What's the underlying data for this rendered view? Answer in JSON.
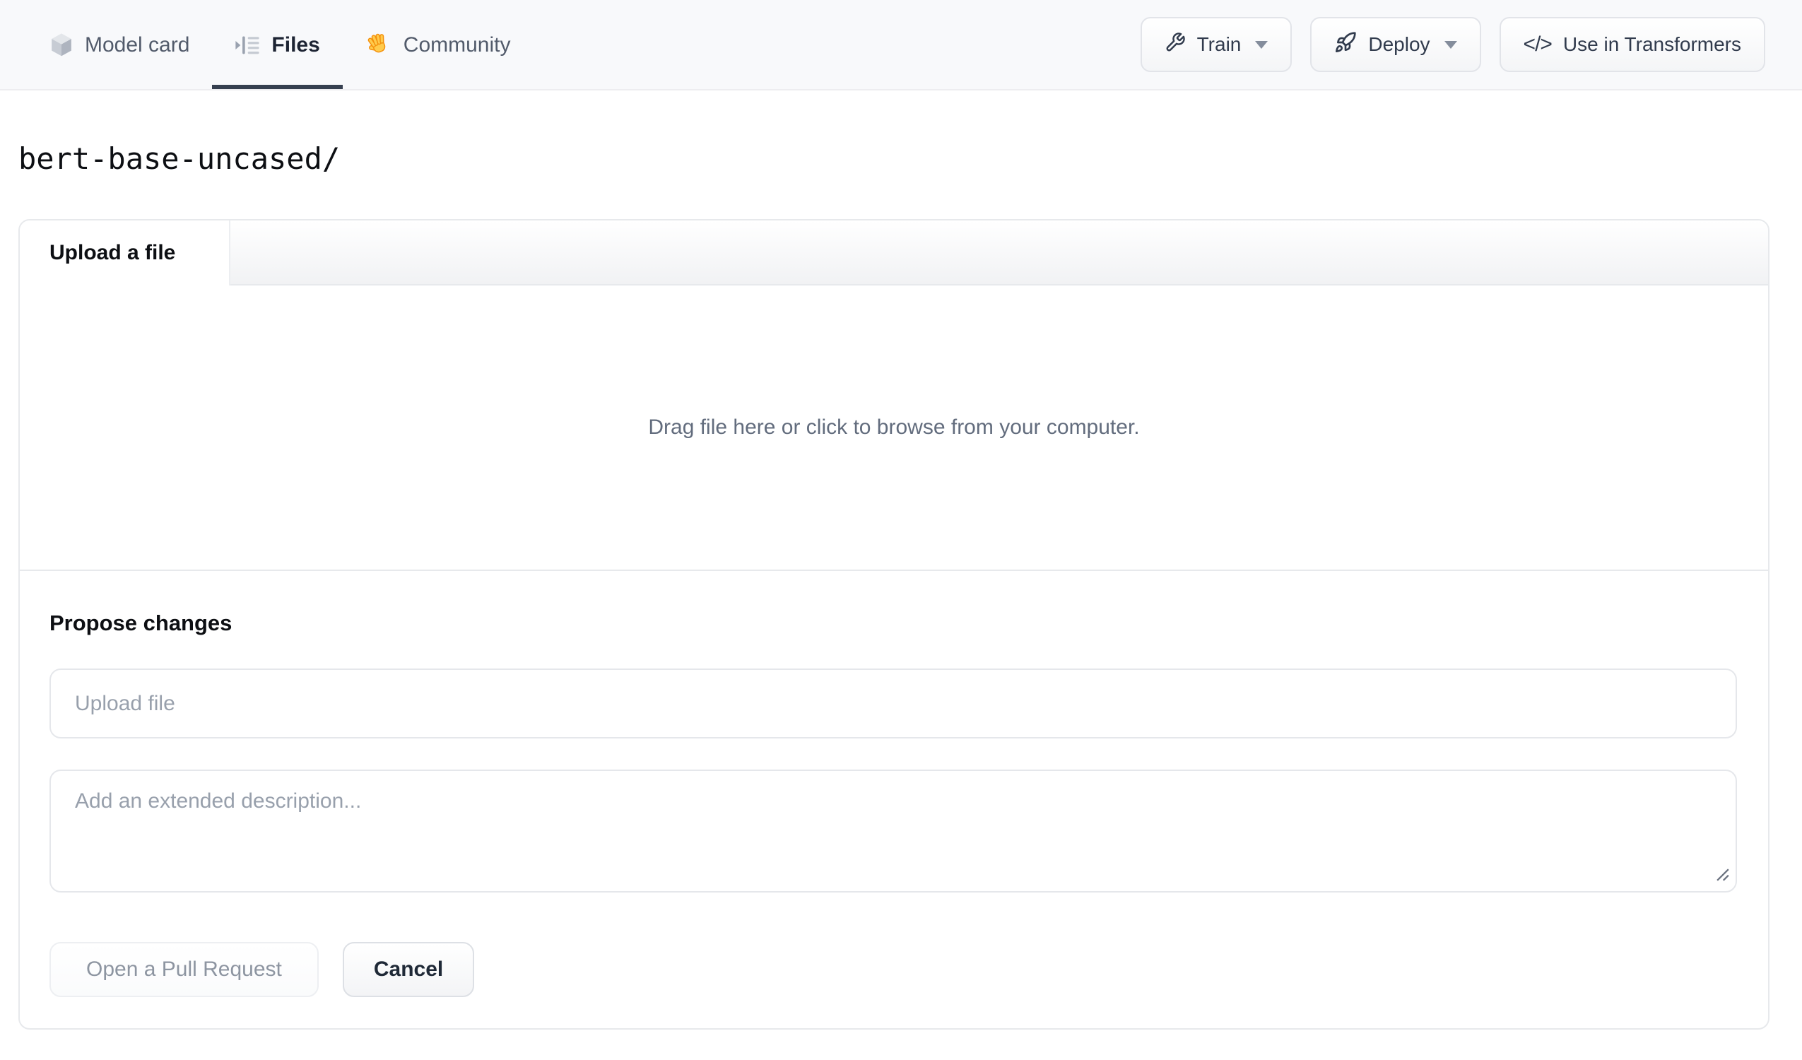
{
  "header": {
    "tabs": [
      {
        "label": "Model card",
        "icon": "cube-icon",
        "active": false
      },
      {
        "label": "Files",
        "icon": "list-tree-icon",
        "active": true
      },
      {
        "label": "Community",
        "icon": "waving-hand-icon",
        "active": false
      }
    ],
    "actions": {
      "train_label": "Train",
      "deploy_label": "Deploy",
      "use_in_transformers_label": "Use in Transformers"
    }
  },
  "breadcrumb": {
    "path": "bert-base-uncased/"
  },
  "upload_card": {
    "tab_label": "Upload a file",
    "dropzone_text": "Drag file here or click to browse from your computer.",
    "propose": {
      "heading": "Propose changes",
      "filename_placeholder": "Upload file",
      "description_placeholder": "Add an extended description...",
      "open_pr_label": "Open a Pull Request",
      "cancel_label": "Cancel"
    }
  },
  "colors": {
    "header_bg": "#f8f9fb",
    "active_tab_underline": "#364050",
    "inactive_tab_text": "#525b6b",
    "active_tab_text": "#1d2433",
    "card_border": "#e7e9ec",
    "muted_text": "#626c7d",
    "placeholder_text": "#98a0ac",
    "disabled_button_text": "#8d95a1",
    "hand_emoji_yellow": "#ffcb4c",
    "hand_emoji_orange": "#f4900c"
  }
}
